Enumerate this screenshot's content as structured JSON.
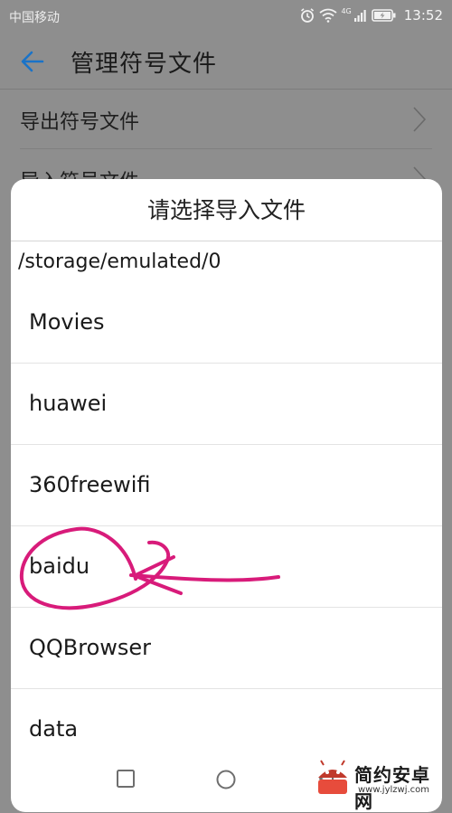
{
  "status_bar": {
    "carrier": "中国移动",
    "network": "4G",
    "time": "13:52"
  },
  "header": {
    "title": "管理符号文件",
    "back_icon": "arrow-left-icon"
  },
  "settings": {
    "items": [
      {
        "label": "导出符号文件"
      },
      {
        "label": "导入符号文件"
      }
    ]
  },
  "dialog": {
    "title": "请选择导入文件",
    "path": "/storage/emulated/0",
    "files": [
      {
        "name": "Movies"
      },
      {
        "name": "huawei"
      },
      {
        "name": "360freewifi"
      },
      {
        "name": "baidu"
      },
      {
        "name": "QQBrowser"
      },
      {
        "name": "data"
      }
    ]
  },
  "watermark": {
    "name": "简约安卓网",
    "url": "www.jylzwj.com"
  },
  "colors": {
    "accent": "#1a73c8",
    "annotation": "#d81b7a",
    "scrim": "#8e8e8e"
  }
}
